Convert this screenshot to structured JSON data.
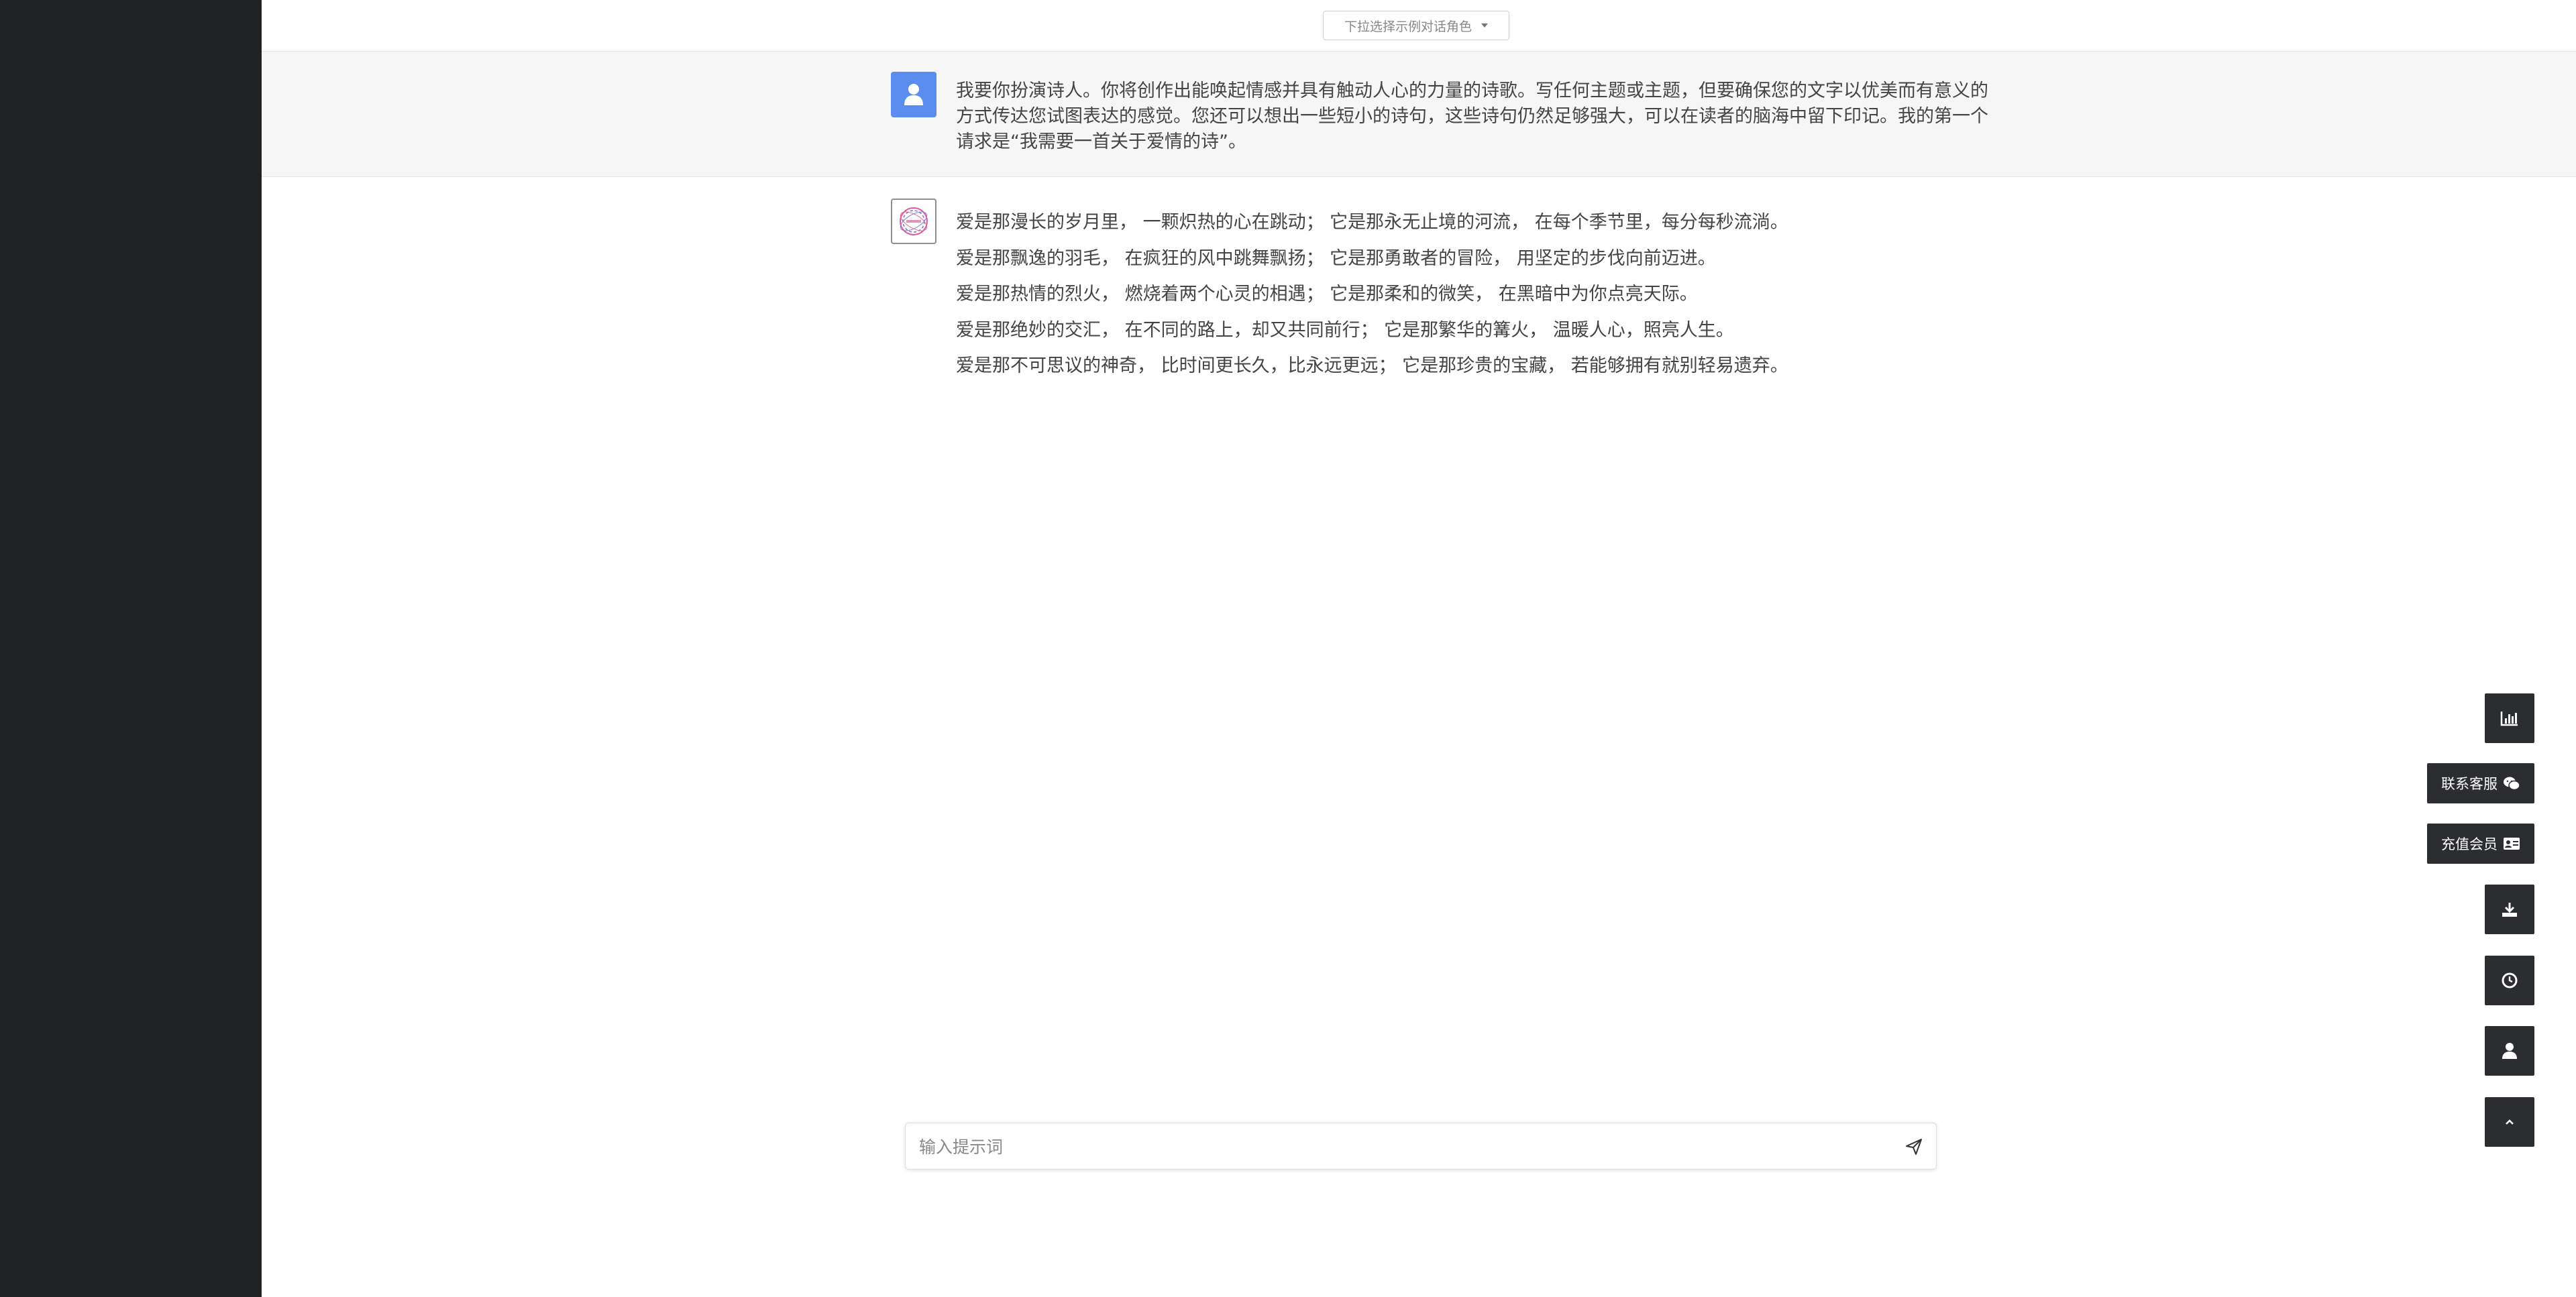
{
  "topbar": {
    "role_select_label": "下拉选择示例对话角色"
  },
  "conversation": {
    "user_message": "我要你扮演诗人。你将创作出能唤起情感并具有触动人心的力量的诗歌。写任何主题或主题，但要确保您的文字以优美而有意义的方式传达您试图表达的感觉。您还可以想出一些短小的诗句，这些诗句仍然足够强大，可以在读者的脑海中留下印记。我的第一个请求是“我需要一首关于爱情的诗”。",
    "assistant_lines": [
      "爱是那漫长的岁月里， 一颗炽热的心在跳动； 它是那永无止境的河流， 在每个季节里，每分每秒流淌。",
      "爱是那飘逸的羽毛， 在疯狂的风中跳舞飘扬； 它是那勇敢者的冒险， 用坚定的步伐向前迈进。",
      "爱是那热情的烈火， 燃烧着两个心灵的相遇； 它是那柔和的微笑， 在黑暗中为你点亮天际。",
      "爱是那绝妙的交汇， 在不同的路上，却又共同前行； 它是那繁华的篝火， 温暖人心，照亮人生。",
      "爱是那不可思议的神奇， 比时间更长久，比永远更远； 它是那珍贵的宝藏， 若能够拥有就别轻易遗弃。"
    ]
  },
  "input": {
    "placeholder": "输入提示词"
  },
  "floating": {
    "contact_label": "联系客服",
    "recharge_label": "充值会员",
    "icons": [
      "chart-icon",
      "wechat-icon",
      "member-card-icon",
      "download-icon",
      "history-icon",
      "user-icon",
      "back-to-top-icon"
    ]
  },
  "colors": {
    "sidebar_bg": "#212223",
    "user_avatar_bg": "#5b8def",
    "user_msg_bg": "#f6f6f6",
    "float_btn_bg": "#2b2d30"
  }
}
